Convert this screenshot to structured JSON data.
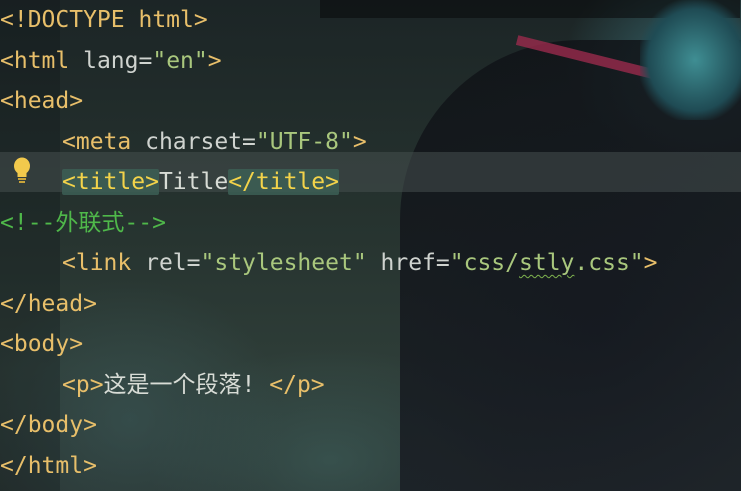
{
  "code_lines": [
    "<!DOCTYPE html>",
    "<html lang=\"en\">",
    "<head>",
    "<meta charset=\"UTF-8\">",
    "<title>Title</title>",
    "<!--外联式-->",
    "<link rel=\"stylesheet\" href=\"css/stly.css\">",
    "</head>",
    "<body>",
    "<p>这是一个段落! </p>",
    "</body>",
    "</html>"
  ],
  "tokens": {
    "doctype": "<!DOCTYPE html>",
    "html_open": "<html",
    "lang_attr": " lang=",
    "lang_value": "\"en\"",
    "tag_close": ">",
    "head_open": "<head>",
    "meta_open": "<meta",
    "charset_attr": " charset=",
    "charset_value": "\"UTF-8\"",
    "title_open": "<title>",
    "title_text": "Title",
    "title_close": "</title>",
    "comment": "<!--外联式-->",
    "link_open": "<link",
    "rel_attr": " rel=",
    "rel_value": "\"stylesheet\"",
    "href_attr": " href=",
    "href_value_quote_open": "\"css/",
    "href_value_squiggle": "stly",
    "href_value_rest": ".css\"",
    "head_close": "</head>",
    "body_open": "<body>",
    "p_open": "<p>",
    "p_text": "这是一个段落! ",
    "p_close": "</p>",
    "body_close": "</body>",
    "html_close": "</html>"
  },
  "icons": {
    "intention_bulb": "lightbulb-icon"
  },
  "colors": {
    "tag": "#e8bf6a",
    "tag_highlight": "#f3d34a",
    "string": "#a9c77d",
    "comment": "#4fb84a",
    "text": "#d8dcd6",
    "bulb": "#f2c94c"
  }
}
